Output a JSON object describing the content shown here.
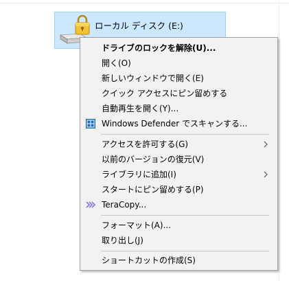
{
  "drive": {
    "label": "ローカル ディスク (E:)",
    "icon": "locked-drive-icon"
  },
  "context_menu": {
    "items": [
      {
        "label": "ドライブのロックを解除(U)...",
        "bold": true
      },
      {
        "label": "開く(O)"
      },
      {
        "label": "新しいウィンドウで開く(E)"
      },
      {
        "label": "クイック アクセスにピン留めする"
      },
      {
        "label": "自動再生を開く(Y)..."
      },
      {
        "label": "Windows Defender でスキャンする...",
        "icon": "windows-defender-icon"
      },
      {
        "label": "アクセスを許可する(G)",
        "submenu": true
      },
      {
        "label": "以前のバージョンの復元(V)"
      },
      {
        "label": "ライブラリに追加(I)",
        "submenu": true
      },
      {
        "label": "スタートにピン留めする(P)"
      },
      {
        "label": "TeraCopy...",
        "icon": "teracopy-icon"
      },
      {
        "label": "フォーマット(A)..."
      },
      {
        "label": "取り出し(J)"
      },
      {
        "label": "ショートカットの作成(S)"
      }
    ]
  },
  "colors": {
    "selection_bg": "#cce8ff",
    "selection_border": "#99d1ff",
    "menu_bg": "#f2f2f2",
    "defender_blue": "#1f6fb5",
    "teracopy_purple": "#8c7fd6"
  }
}
